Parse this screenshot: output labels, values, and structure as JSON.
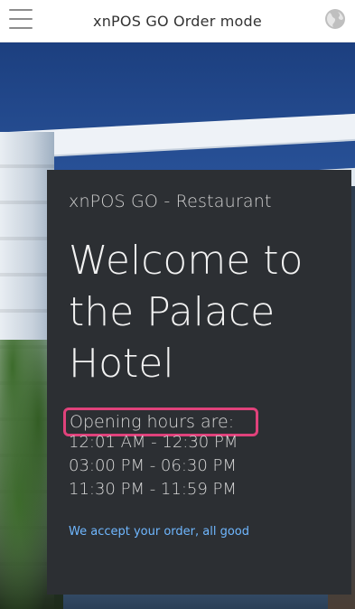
{
  "header": {
    "title": "xnPOS GO Order mode",
    "menu_icon": "hamburger-menu-icon",
    "language_icon": "globe-icon"
  },
  "card": {
    "subtitle": "xnPOS GO - Restaurant",
    "welcome": "Welcome to the Palace Hotel",
    "hours_title": "Opening hours are:",
    "hours": [
      "12:01 AM - 12:30 PM",
      "03:00 PM - 06:30 PM",
      "11:30 PM - 11:59 PM"
    ],
    "status": "We accept your order, all good"
  },
  "colors": {
    "card_bg": "#2c2f33",
    "highlight_border": "#e0427b",
    "status_link": "#6fb7ff"
  }
}
